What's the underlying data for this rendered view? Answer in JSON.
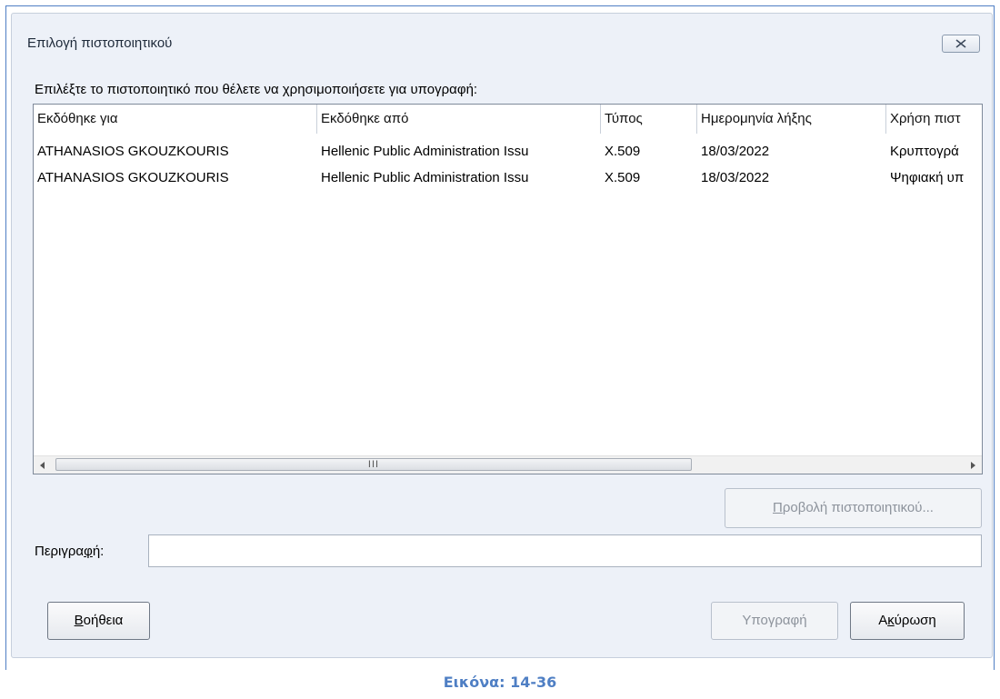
{
  "dialog": {
    "title": "Επιλογή πιστοποιητικού",
    "prompt": "Επιλέξτε το πιστοποιητικό που θέλετε να χρησιμοποιήσετε για υπογραφή:"
  },
  "table": {
    "columns": [
      "Εκδόθηκε για",
      "Εκδόθηκε από",
      "Τύπος",
      "Ημερομηνία λήξης",
      "Χρήση πιστ"
    ],
    "rows": [
      [
        "ATHANASIOS GKOUZKOURIS",
        "Hellenic Public Administration Issu",
        "X.509",
        "18/03/2022",
        "Κρυπτογρά"
      ],
      [
        "ATHANASIOS GKOUZKOURIS",
        "Hellenic Public Administration Issu",
        "X.509",
        "18/03/2022",
        "Ψηφιακή υπ"
      ]
    ],
    "scroll_grip": "III"
  },
  "buttons": {
    "view_cert_first": "Π",
    "view_cert_rest": "ροβολή πιστοποιητικού...",
    "help_first": "Β",
    "help_rest": "οήθεια",
    "sign": "Υπογραφή",
    "cancel_pre": "Α",
    "cancel_ul": "κ",
    "cancel_rest": "ύρωση"
  },
  "description": {
    "label_pre": "Περιγρα",
    "label_ul": "φ",
    "label_post": "ή:",
    "value": ""
  },
  "caption": "Εικόνα: 14-36",
  "colors": {
    "frame": "#4f7fc4",
    "dialog_bg": "#edf1f8",
    "disabled_text": "#8d939c"
  }
}
